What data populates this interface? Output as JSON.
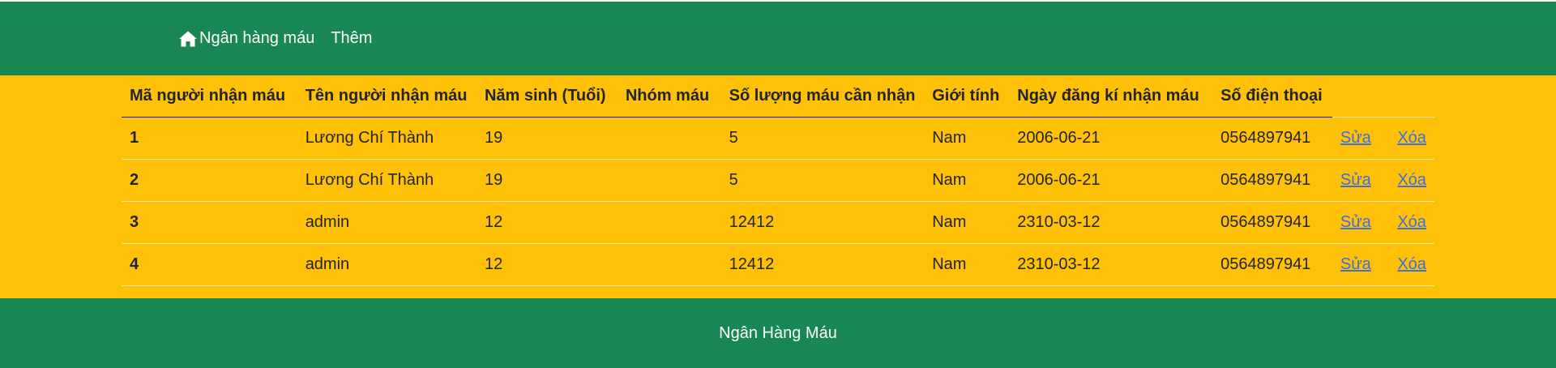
{
  "navbar": {
    "brand_icon": "home-icon",
    "brand_label": "Ngân hàng máu",
    "add_label": "Thêm"
  },
  "table": {
    "headers": [
      "Mã người nhận máu",
      "Tên người nhận máu",
      "Năm sinh (Tuổi)",
      "Nhóm máu",
      "Số lượng máu cần nhận",
      "Giới tính",
      "Ngày đăng kí nhận máu",
      "Số điện thoại"
    ],
    "rows": [
      {
        "id": "1",
        "name": "Lương Chí Thành",
        "birth": "19",
        "blood_group": "",
        "quantity": "5",
        "gender": "Nam",
        "register_date": "2006-06-21",
        "phone": "0564897941",
        "edit": "Sửa",
        "delete": "Xóa"
      },
      {
        "id": "2",
        "name": "Lương Chí Thành",
        "birth": "19",
        "blood_group": "",
        "quantity": "5",
        "gender": "Nam",
        "register_date": "2006-06-21",
        "phone": "0564897941",
        "edit": "Sửa",
        "delete": "Xóa"
      },
      {
        "id": "3",
        "name": "admin",
        "birth": "12",
        "blood_group": "",
        "quantity": "12412",
        "gender": "Nam",
        "register_date": "2310-03-12",
        "phone": "0564897941",
        "edit": "Sửa",
        "delete": "Xóa"
      },
      {
        "id": "4",
        "name": "admin",
        "birth": "12",
        "blood_group": "",
        "quantity": "12412",
        "gender": "Nam",
        "register_date": "2310-03-12",
        "phone": "0564897941",
        "edit": "Sửa",
        "delete": "Xóa"
      }
    ]
  },
  "footer": {
    "text": "Ngân Hàng Máu"
  },
  "colors": {
    "navbar": "#198754",
    "main": "#ffc107",
    "footer": "#198754",
    "link": "#3f6fd8"
  }
}
